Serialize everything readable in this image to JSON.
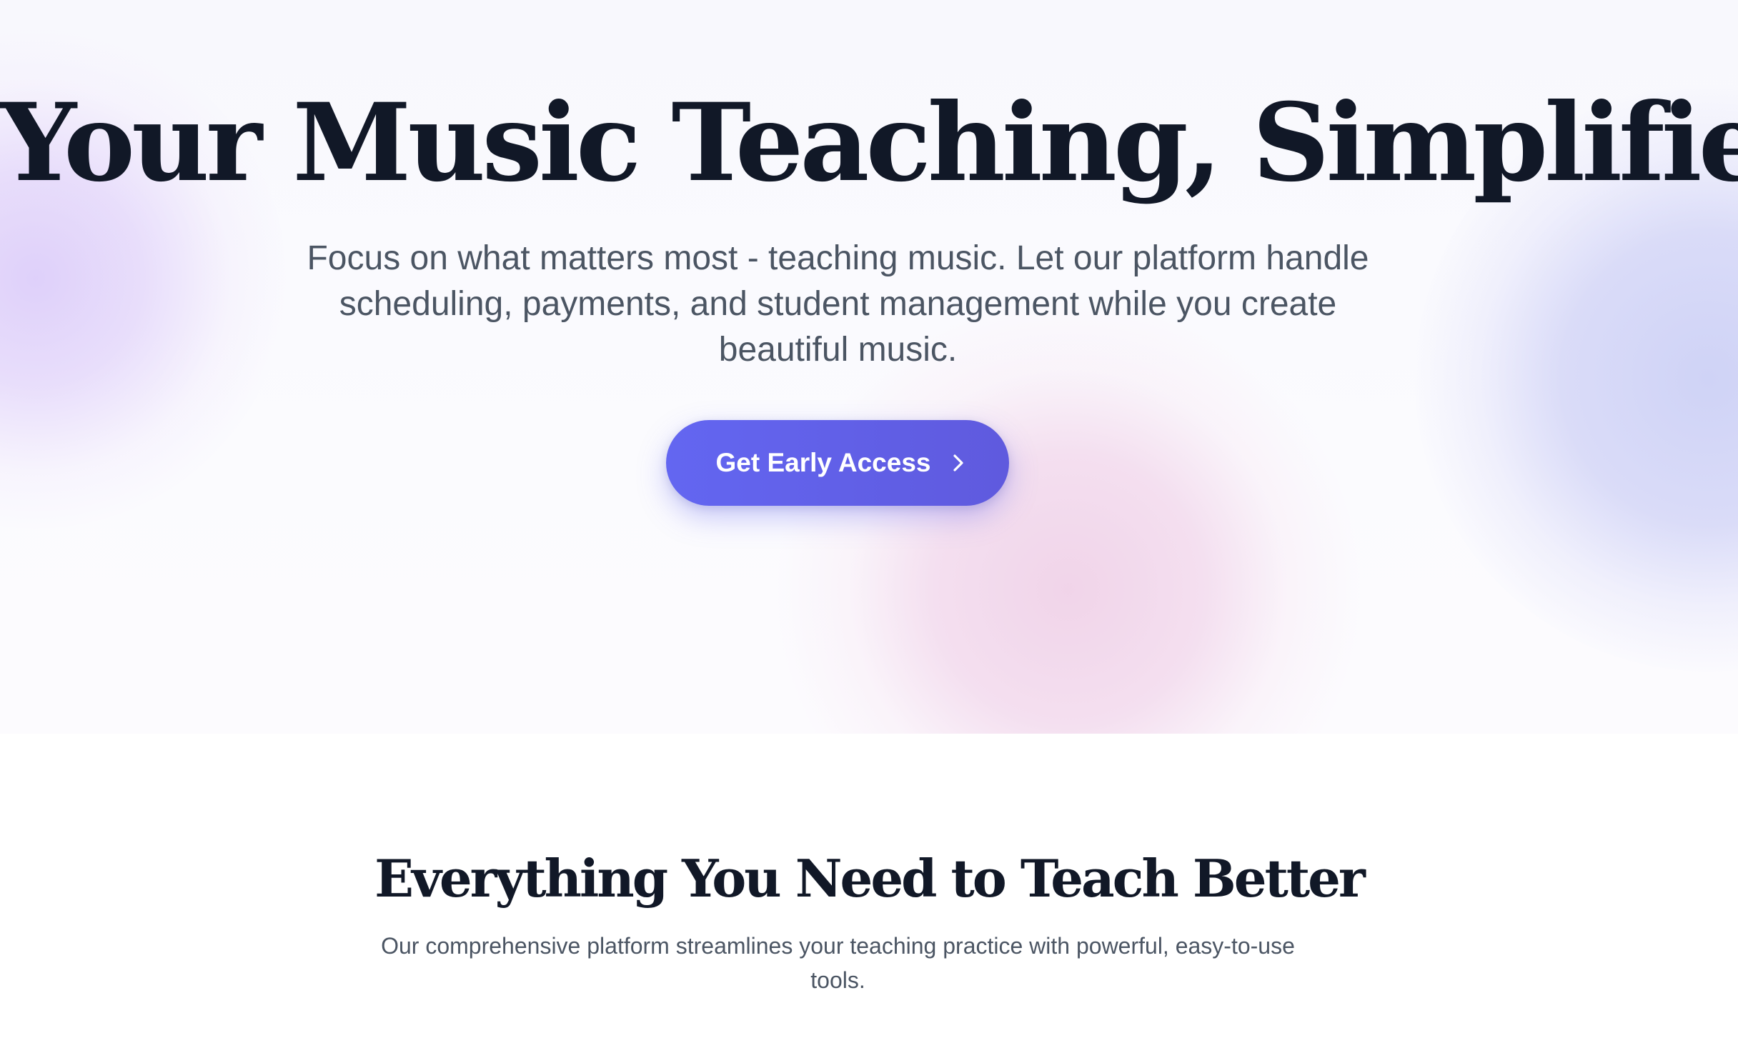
{
  "hero": {
    "title": "Your Music Teaching, Simplified",
    "subtitle": "Focus on what matters most - teaching music. Let our platform handle scheduling, payments, and student management while you create beautiful music.",
    "cta": {
      "label": "Get Early Access",
      "icon": "chevron-right-icon",
      "color": "#6366f1"
    }
  },
  "features": {
    "title": "Everything You Need to Teach Better",
    "subtitle": "Our comprehensive platform streamlines your teaching practice with powerful, easy-to-use tools."
  },
  "colors": {
    "heading": "#111827",
    "body_text": "#4b5563",
    "accent": "#6366f1"
  }
}
